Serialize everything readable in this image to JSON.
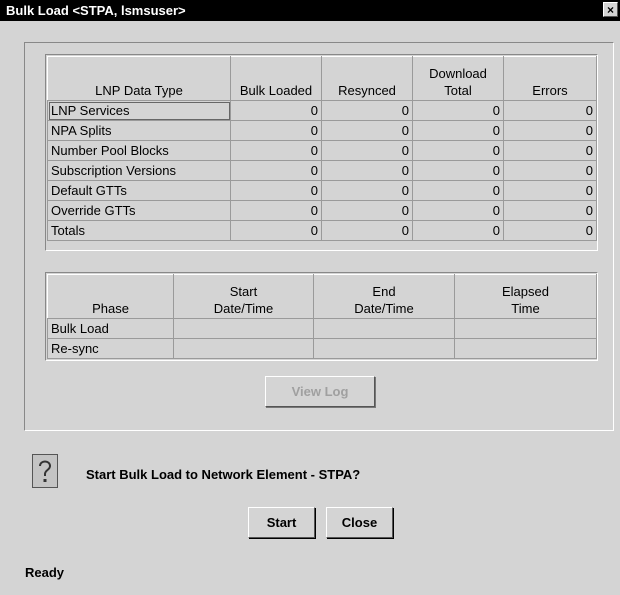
{
  "window": {
    "title": "Bulk Load <STPA, lsmsuser>",
    "close_label": "×"
  },
  "data_table": {
    "headers": [
      "LNP Data Type",
      "Bulk Loaded",
      "Resynced",
      "Download Total",
      "Errors"
    ],
    "rows": [
      {
        "type": "LNP Services",
        "bulk_loaded": "0",
        "resynced": "0",
        "download_total": "0",
        "errors": "0"
      },
      {
        "type": "NPA Splits",
        "bulk_loaded": "0",
        "resynced": "0",
        "download_total": "0",
        "errors": "0"
      },
      {
        "type": "Number Pool Blocks",
        "bulk_loaded": "0",
        "resynced": "0",
        "download_total": "0",
        "errors": "0"
      },
      {
        "type": "Subscription Versions",
        "bulk_loaded": "0",
        "resynced": "0",
        "download_total": "0",
        "errors": "0"
      },
      {
        "type": "Default GTTs",
        "bulk_loaded": "0",
        "resynced": "0",
        "download_total": "0",
        "errors": "0"
      },
      {
        "type": "Override GTTs",
        "bulk_loaded": "0",
        "resynced": "0",
        "download_total": "0",
        "errors": "0"
      },
      {
        "type": "Totals",
        "bulk_loaded": "0",
        "resynced": "0",
        "download_total": "0",
        "errors": "0"
      }
    ]
  },
  "phase_table": {
    "headers": [
      "Phase",
      "Start Date/Time",
      "End Date/Time",
      "Elapsed Time"
    ],
    "rows": [
      {
        "phase": "Bulk Load",
        "start": "",
        "end": "",
        "elapsed": ""
      },
      {
        "phase": "Re-sync",
        "start": "",
        "end": "",
        "elapsed": ""
      }
    ]
  },
  "buttons": {
    "view_log": "View Log",
    "start": "Start",
    "close": "Close"
  },
  "prompt": {
    "icon": "question-icon",
    "text": "Start Bulk Load to Network Element - STPA?"
  },
  "status": "Ready"
}
